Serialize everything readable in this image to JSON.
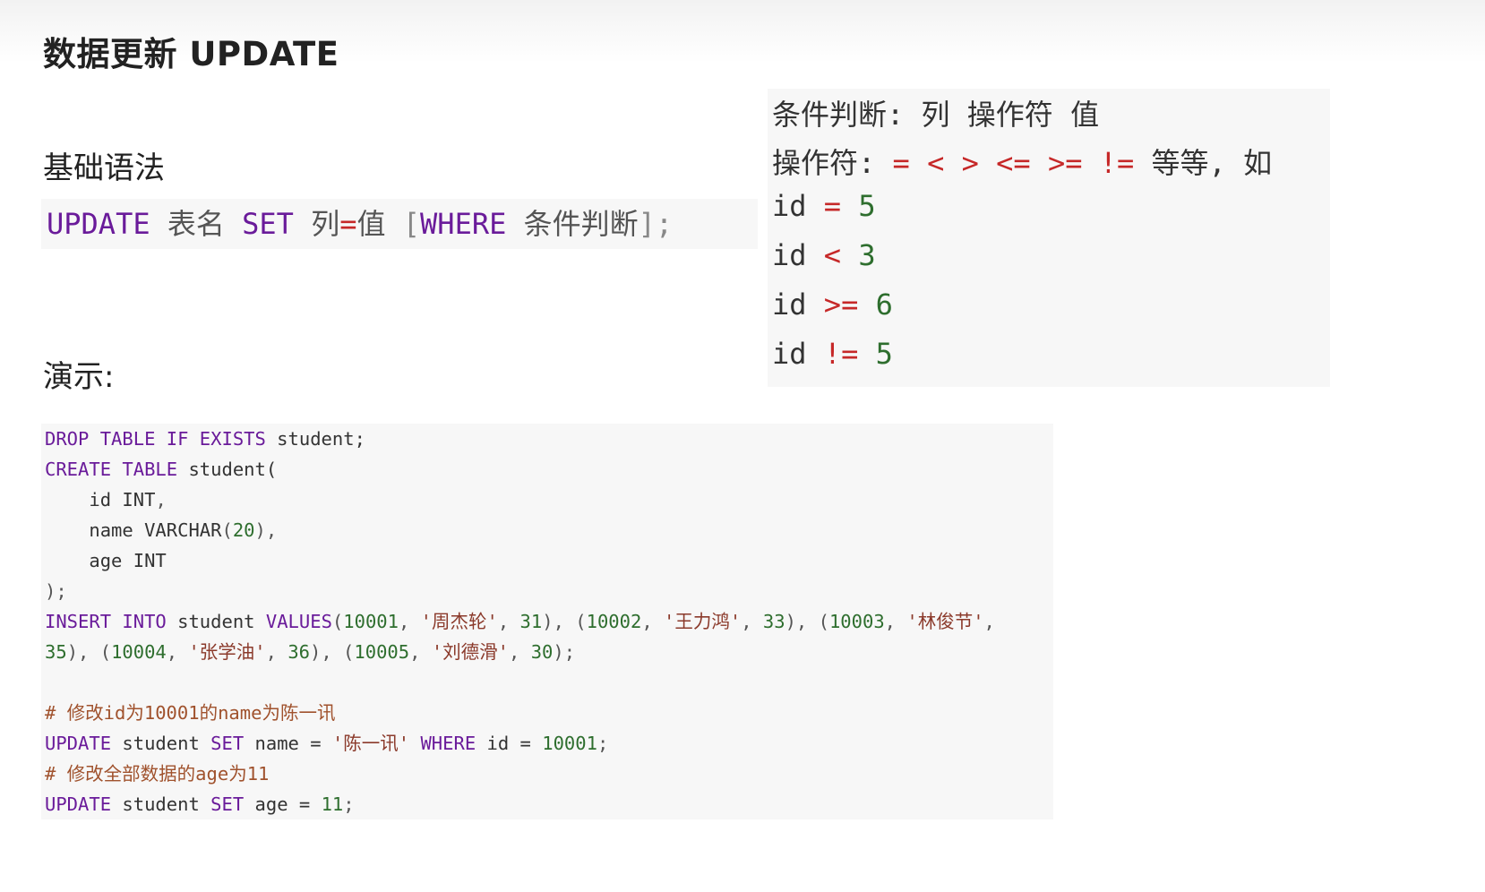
{
  "title": "数据更新 UPDATE",
  "headings": {
    "syntax": "基础语法",
    "demo": "演示:"
  },
  "syntax": {
    "kw_update": "UPDATE",
    "table_name": "表名",
    "kw_set": "SET",
    "col": "列",
    "eq": "=",
    "val": "值",
    "lbracket": "[",
    "kw_where": "WHERE",
    "condition": "条件判断",
    "rbracket": "];"
  },
  "conditions": {
    "line1": "条件判断: 列 操作符 值",
    "line2_label": "操作符:",
    "operators": "= < > <= >= !=",
    "line2_tail": "等等, 如",
    "examples": [
      {
        "col": "id",
        "op": "=",
        "val": "5"
      },
      {
        "col": "id",
        "op": "<",
        "val": "3"
      },
      {
        "col": "id",
        "op": ">=",
        "val": "6"
      },
      {
        "col": "id",
        "op": "!=",
        "val": "5"
      }
    ]
  },
  "code": {
    "l1_kw": "DROP TABLE IF EXISTS",
    "l1_rest": " student;",
    "l2_kw": "CREATE TABLE",
    "l2_rest": " student(",
    "l3_col": "    id ",
    "l3_type": "INT",
    "l3_end": ",",
    "l4_col": "    name ",
    "l4_type": "VARCHAR",
    "l4_p1": "(",
    "l4_num": "20",
    "l4_p2": "),",
    "l5_col": "    age ",
    "l5_type": "INT",
    "l6": ");",
    "l7_kw1": "INSERT INTO",
    "l7_tbl": " student ",
    "l7_kw2": "VALUES",
    "l7_a": "(",
    "l7_n1": "10001",
    "l7_s1": "'周杰轮'",
    "l7_a1": "31",
    "l7_n2": "10002",
    "l7_s2": "'王力鸿'",
    "l7_a2": "33",
    "l7_n3": "10003",
    "l7_s3": "'林俊节'",
    "l8_a3": "35",
    "l8_n4": "10004",
    "l8_s4": "'张学油'",
    "l8_a4": "36",
    "l8_n5": "10005",
    "l8_s5": "'刘德滑'",
    "l8_a5": "30",
    "c1": "# 修改id为10001的name为陈一讯",
    "l10_kw1": "UPDATE",
    "l10_tbl": " student ",
    "l10_kw2": "SET",
    "l10_set": " name = ",
    "l10_str": "'陈一讯'",
    "l10_kw3": "WHERE",
    "l10_cond": " id = ",
    "l10_num": "10001",
    "l10_end": ";",
    "c2": "# 修改全部数据的age为11",
    "l12_kw1": "UPDATE",
    "l12_tbl": " student ",
    "l12_kw2": "SET",
    "l12_set": " age = ",
    "l12_num": "11",
    "l12_end": ";"
  }
}
